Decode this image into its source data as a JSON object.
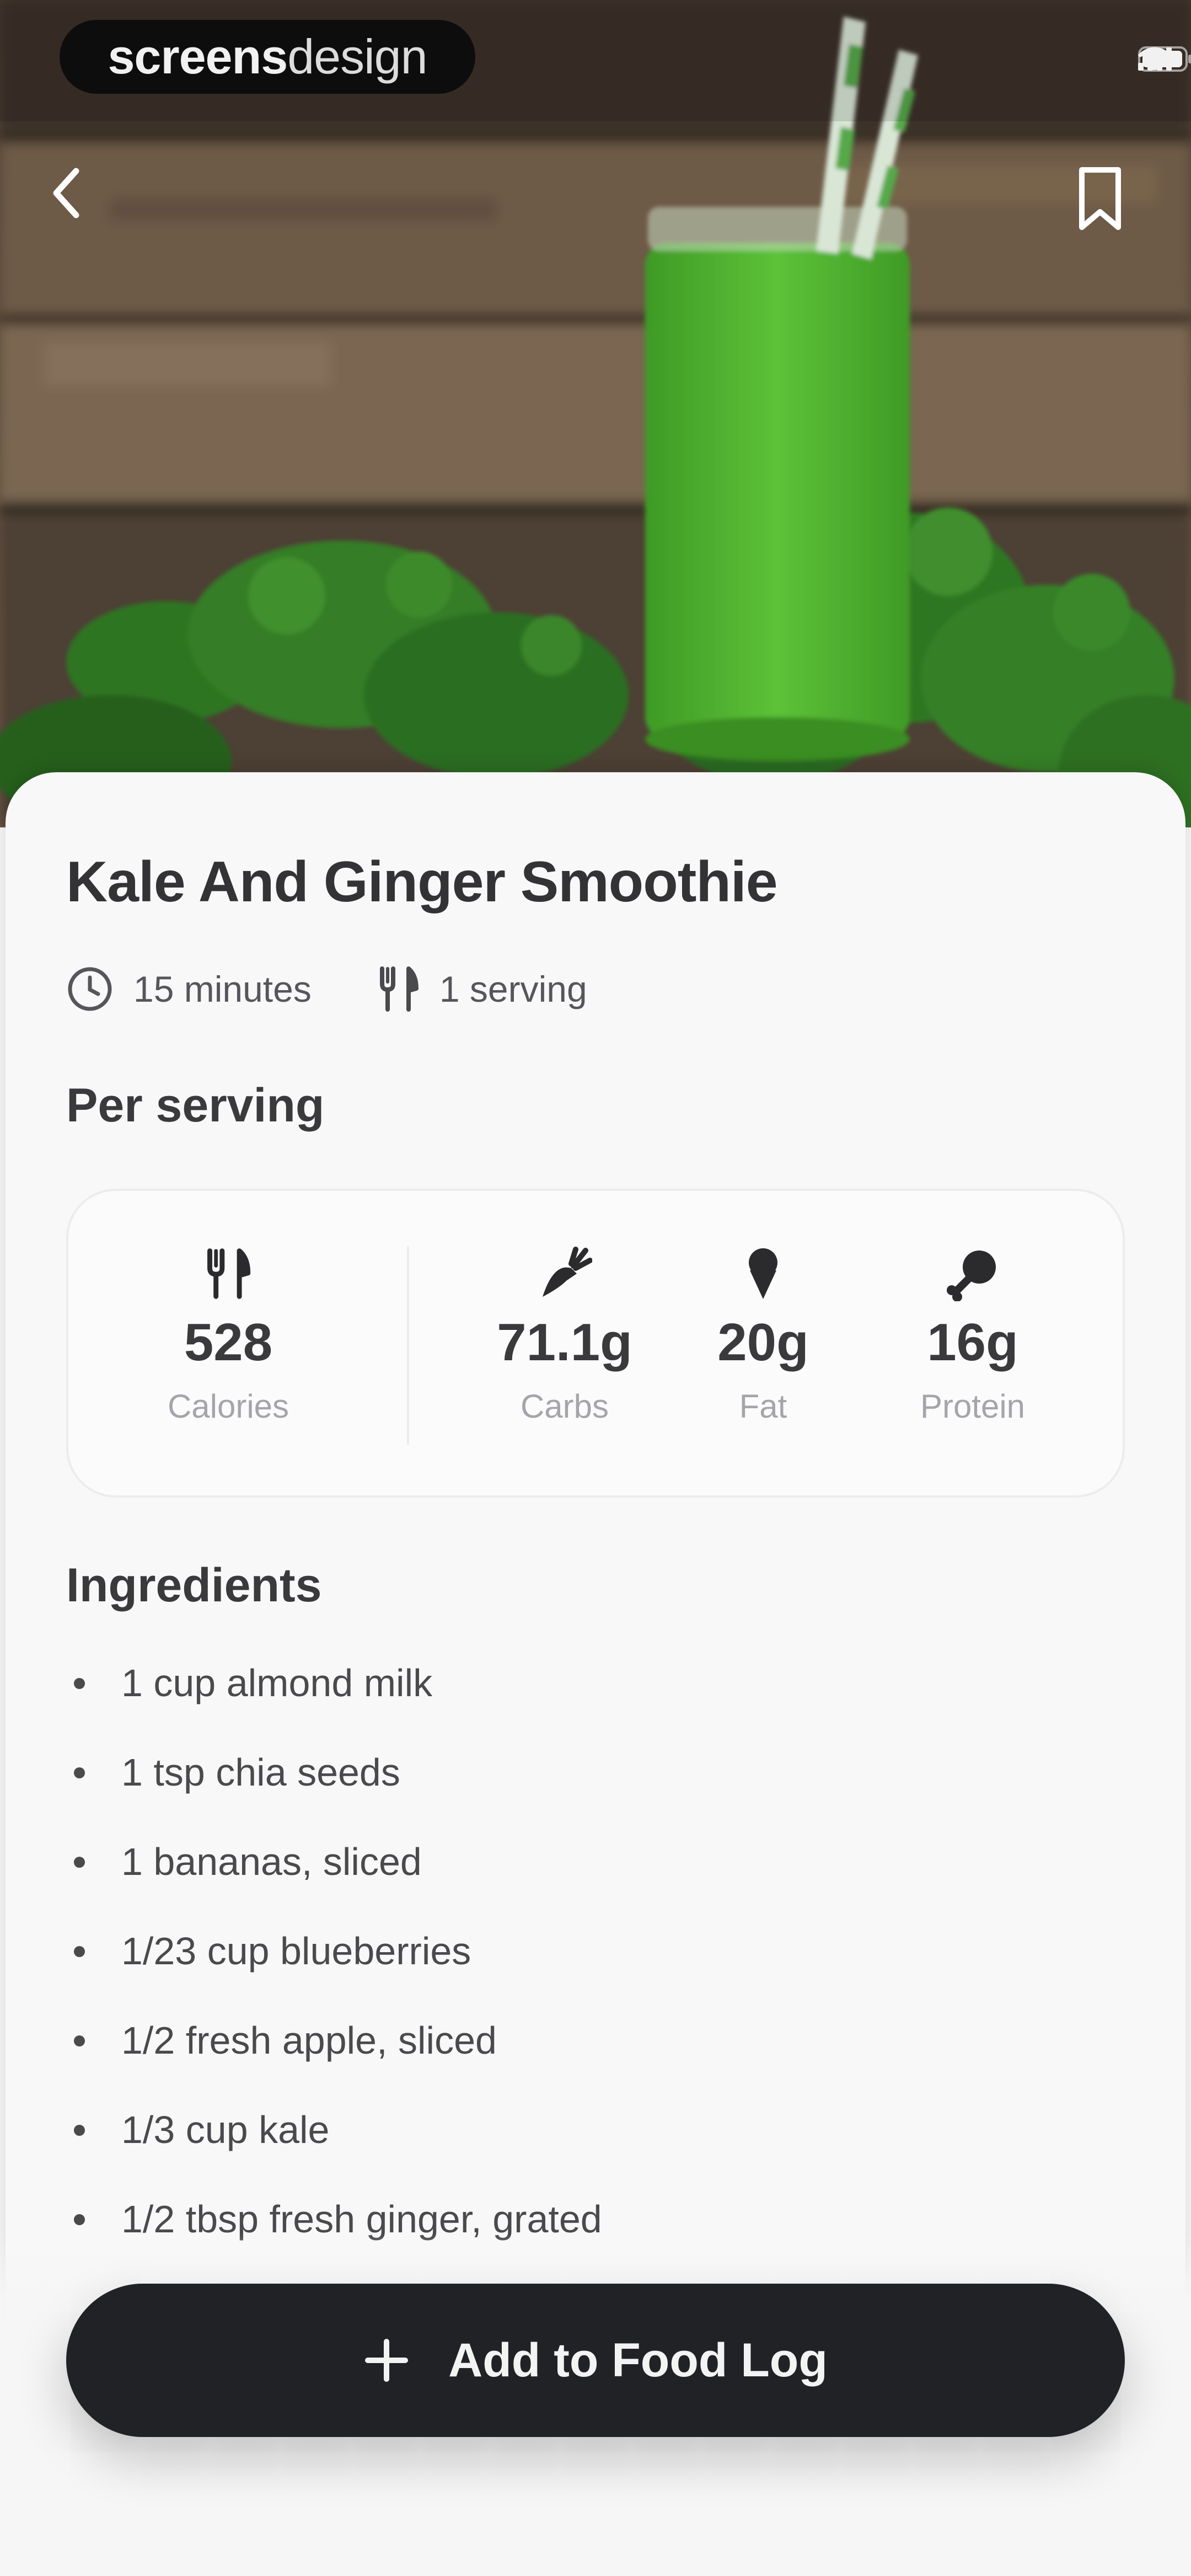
{
  "watermark": {
    "bold": "screens",
    "light": "design"
  },
  "recipe": {
    "title": "Kale And Ginger Smoothie",
    "time": "15 minutes",
    "servings": "1 serving"
  },
  "per_serving_label": "Per serving",
  "nutrition": [
    {
      "icon": "fork-knife-icon",
      "value": "528",
      "label": "Calories"
    },
    {
      "icon": "carrot-icon",
      "value": "71.1g",
      "label": "Carbs"
    },
    {
      "icon": "ice-cream-icon",
      "value": "20g",
      "label": "Fat"
    },
    {
      "icon": "drumstick-icon",
      "value": "16g",
      "label": "Protein"
    }
  ],
  "ingredients_label": "Ingredients",
  "ingredients": [
    "1 cup almond milk",
    "1 tsp chia seeds",
    "1 bananas, sliced",
    "1/23 cup blueberries",
    "1/2 fresh apple, sliced",
    "1/3 cup kale",
    "1/2 tbsp fresh ginger, grated"
  ],
  "cta": {
    "label": "Add to Food Log",
    "icon": "plus-icon"
  },
  "colors": {
    "button": "#202226",
    "card": "#f8f8f9",
    "smoothie": "#4cae2f",
    "kale": "#2f7a24"
  }
}
